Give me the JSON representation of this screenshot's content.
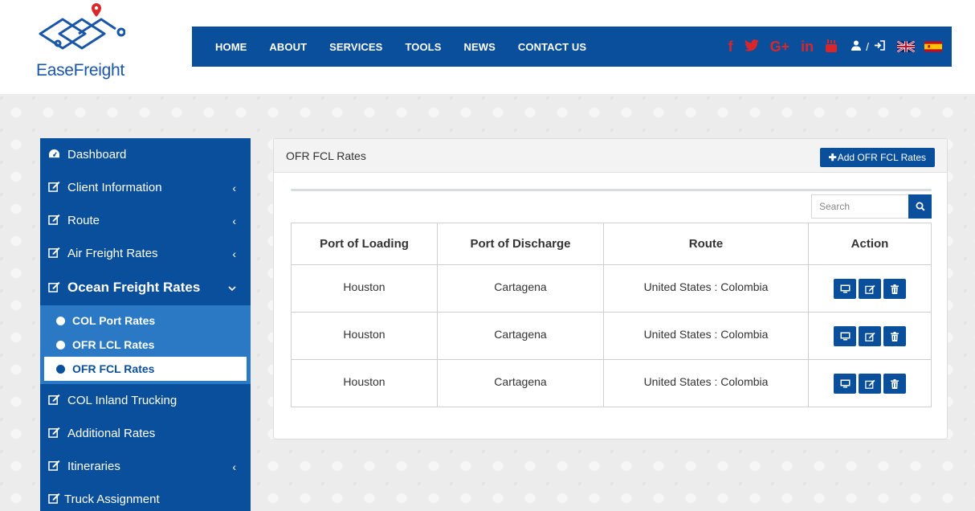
{
  "brand": {
    "name": "EaseFreight"
  },
  "nav": {
    "items": [
      "HOME",
      "ABOUT",
      "SERVICES",
      "TOOLS",
      "NEWS",
      "CONTACT US"
    ],
    "separator": "/"
  },
  "colors": {
    "primary": "#0a4f9c",
    "social": "#d9262b",
    "sub_bg": "#2b79c4"
  },
  "sidebar": {
    "items": [
      {
        "label": "Dashboard",
        "icon": "dashboard-icon"
      },
      {
        "label": "Client Information",
        "icon": "edit-icon"
      },
      {
        "label": "Route",
        "icon": "edit-icon"
      },
      {
        "label": "Air Freight Rates",
        "icon": "edit-icon"
      },
      {
        "label": "Ocean Freight Rates",
        "icon": "edit-icon"
      },
      {
        "label": "COL Inland Trucking",
        "icon": "edit-icon"
      },
      {
        "label": "Additional Rates",
        "icon": "edit-icon"
      },
      {
        "label": "Itineraries",
        "icon": "edit-icon"
      },
      {
        "label": "Truck Assignment",
        "icon": "edit-icon"
      }
    ],
    "sub_items": [
      "COL Port Rates",
      "OFR LCL Rates",
      "OFR FCL Rates"
    ]
  },
  "panel": {
    "title": "OFR FCL Rates",
    "add_button": "Add OFR FCL Rates",
    "search_placeholder": "Search",
    "columns": [
      "Port of Loading",
      "Port of Discharge",
      "Route",
      "Action"
    ],
    "rows": [
      [
        "Houston",
        "Cartagena",
        "United States : Colombia"
      ],
      [
        "Houston",
        "Cartagena",
        "United States : Colombia"
      ],
      [
        "Houston",
        "Cartagena",
        "United States : Colombia"
      ]
    ]
  }
}
